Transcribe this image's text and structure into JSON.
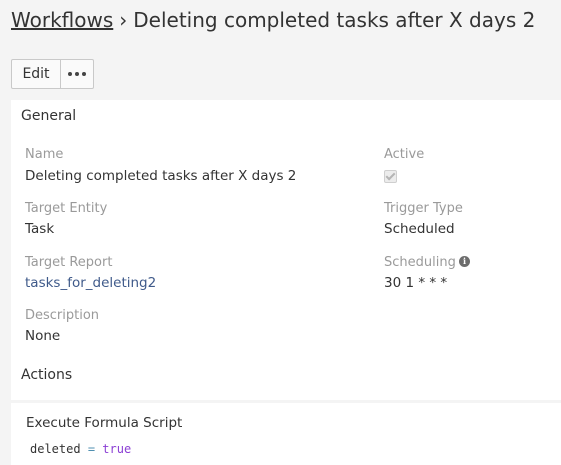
{
  "breadcrumb": {
    "parent": "Workflows",
    "separator": "›",
    "current": "Deleting completed tasks after X days 2"
  },
  "toolbar": {
    "edit_label": "Edit",
    "more_icon": "ellipsis-horizontal-icon"
  },
  "general": {
    "title": "General",
    "name_label": "Name",
    "name_value": "Deleting completed tasks after X days 2",
    "active_label": "Active",
    "active_checked": true,
    "target_entity_label": "Target Entity",
    "target_entity_value": "Task",
    "trigger_type_label": "Trigger Type",
    "trigger_type_value": "Scheduled",
    "target_report_label": "Target Report",
    "target_report_value": "tasks_for_deleting2",
    "scheduling_label": "Scheduling",
    "scheduling_value": "30 1 * * *",
    "description_label": "Description",
    "description_value": "None"
  },
  "actions": {
    "title": "Actions",
    "items": [
      {
        "title": "Execute Formula Script",
        "code": {
          "var": "deleted",
          "op": "=",
          "val": "true"
        }
      }
    ]
  },
  "colors": {
    "background": "#f4f4f4",
    "link": "#3f5a8a",
    "label": "#9a9a9a",
    "code_keyword": "#8b3fd4"
  }
}
